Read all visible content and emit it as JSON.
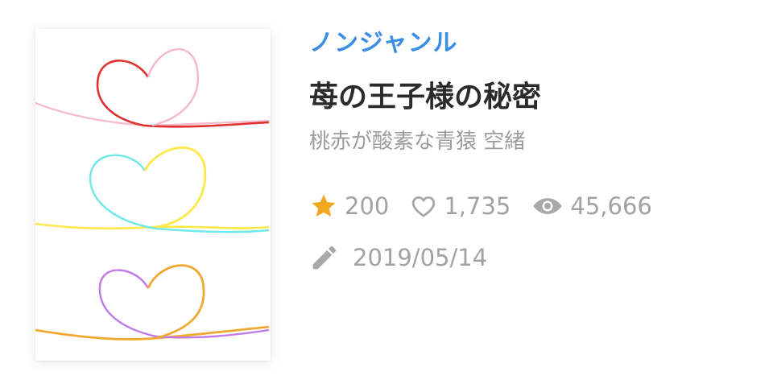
{
  "work": {
    "genre": "ノンジャンル",
    "title": "苺の王子様の秘密",
    "author": "桃赤が酸素な青猿 空緒",
    "stats": {
      "stars": "200",
      "likes": "1,735",
      "views": "45,666"
    },
    "date": "2019/05/14"
  },
  "icons": {
    "star": "star-icon",
    "heart": "heart-outline-icon",
    "eye": "eye-icon",
    "pencil": "pencil-icon"
  },
  "colors": {
    "genre": "#3a8ee6",
    "star": "#f4a822",
    "text_muted": "#a2a2a2",
    "title": "#2b2b2b"
  }
}
